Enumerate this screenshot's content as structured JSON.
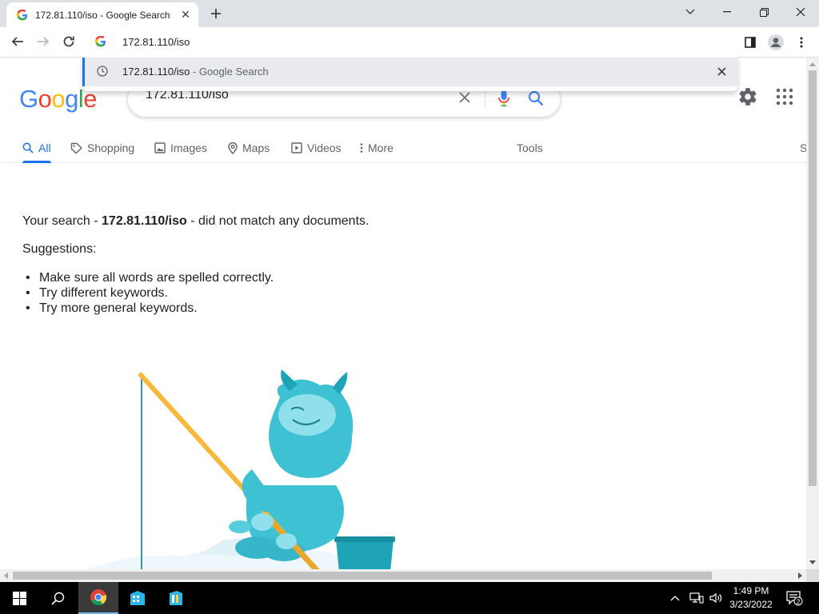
{
  "browser": {
    "tab_title": "172.81.110/iso - Google Search",
    "address": "172.81.110/iso",
    "suggestion": {
      "query": "172.81.110/iso",
      "separator": " - ",
      "source": "Google Search"
    }
  },
  "page": {
    "logo_letters": [
      "G",
      "o",
      "o",
      "g",
      "l",
      "e"
    ],
    "logo_colors": [
      "#4285F4",
      "#EA4335",
      "#FBBC05",
      "#4285F4",
      "#34A853",
      "#EA4335"
    ],
    "search_value": "172.81.110/iso",
    "tabs": {
      "all": "All",
      "shopping": "Shopping",
      "images": "Images",
      "maps": "Maps",
      "videos": "Videos",
      "more": "More",
      "tools": "Tools",
      "overflow": "S"
    },
    "result": {
      "prefix": "Your search - ",
      "query": "172.81.110/iso",
      "suffix": " - did not match any documents."
    },
    "suggestions_heading": "Suggestions:",
    "suggestions": [
      "Make sure all words are spelled correctly.",
      "Try different keywords.",
      "Try more general keywords."
    ]
  },
  "taskbar": {
    "time": "1:49 PM",
    "date": "3/23/2022",
    "notification_count": "2"
  },
  "colors": {
    "accent": "#1a73e8",
    "tab_text": "#5f6368"
  }
}
